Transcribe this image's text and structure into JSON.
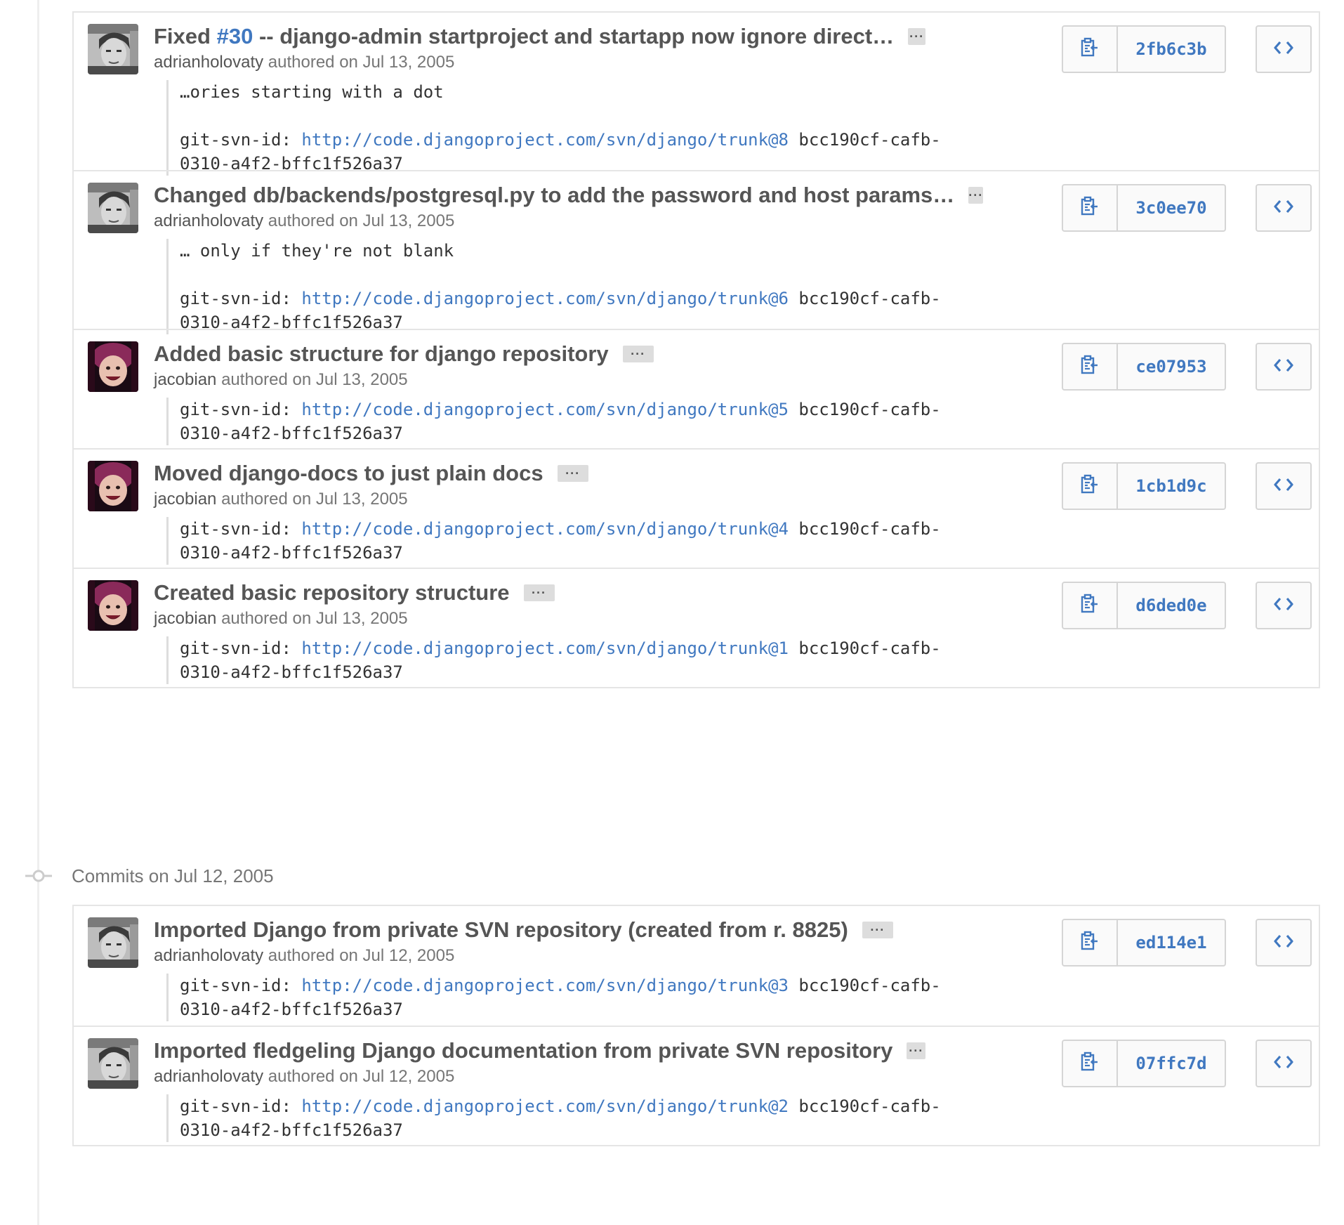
{
  "colors": {
    "link": "#4078c0",
    "title": "#555555",
    "meta": "#767676",
    "border": "#e5e5e5"
  },
  "groups": [
    {
      "date_label": "",
      "commits": [
        {
          "title_prefix": "Fixed ",
          "issue": "#30",
          "title_rest": " -- django-admin startproject and startapp now ignore direct…",
          "author": "adrianholovaty",
          "authored": " authored on Jul 13, 2005",
          "desc_first": "…ories starting with a dot",
          "svn_label": "git-svn-id: ",
          "svn_url": "http://code.djangoproject.com/svn/django/trunk@8",
          "svn_rest": " bcc190cf-cafb-\n0310-a4f2-bffc1f526a37",
          "sha": "2fb6c3b",
          "avatar": "adrian-avatar"
        },
        {
          "title_prefix": "Changed db/backends/postgresql.py to add the password and host params…",
          "issue": "",
          "title_rest": "",
          "author": "adrianholovaty",
          "authored": " authored on Jul 13, 2005",
          "desc_first": "… only if they're not blank",
          "svn_label": "git-svn-id: ",
          "svn_url": "http://code.djangoproject.com/svn/django/trunk@6",
          "svn_rest": " bcc190cf-cafb-\n0310-a4f2-bffc1f526a37",
          "sha": "3c0ee70",
          "avatar": "adrian-avatar"
        },
        {
          "title_prefix": "Added basic structure for django repository",
          "issue": "",
          "title_rest": "",
          "author": "jacobian",
          "authored": " authored on Jul 13, 2005",
          "desc_first": "",
          "svn_label": "git-svn-id: ",
          "svn_url": "http://code.djangoproject.com/svn/django/trunk@5",
          "svn_rest": " bcc190cf-cafb-\n0310-a4f2-bffc1f526a37",
          "sha": "ce07953",
          "avatar": "jacob-avatar"
        },
        {
          "title_prefix": "Moved django-docs to just plain docs",
          "issue": "",
          "title_rest": "",
          "author": "jacobian",
          "authored": " authored on Jul 13, 2005",
          "desc_first": "",
          "svn_label": "git-svn-id: ",
          "svn_url": "http://code.djangoproject.com/svn/django/trunk@4",
          "svn_rest": " bcc190cf-cafb-\n0310-a4f2-bffc1f526a37",
          "sha": "1cb1d9c",
          "avatar": "jacob-avatar"
        },
        {
          "title_prefix": "Created basic repository structure",
          "issue": "",
          "title_rest": "",
          "author": "jacobian",
          "authored": " authored on Jul 13, 2005",
          "desc_first": "",
          "svn_label": "git-svn-id: ",
          "svn_url": "http://code.djangoproject.com/svn/django/trunk@1",
          "svn_rest": " bcc190cf-cafb-\n0310-a4f2-bffc1f526a37",
          "sha": "d6ded0e",
          "avatar": "jacob-avatar"
        }
      ]
    },
    {
      "date_label": "Commits on Jul 12, 2005",
      "commits": [
        {
          "title_prefix": "Imported Django from private SVN repository (created from r. 8825)",
          "issue": "",
          "title_rest": "",
          "author": "adrianholovaty",
          "authored": " authored on Jul 12, 2005",
          "desc_first": "",
          "svn_label": "git-svn-id: ",
          "svn_url": "http://code.djangoproject.com/svn/django/trunk@3",
          "svn_rest": " bcc190cf-cafb-\n0310-a4f2-bffc1f526a37",
          "sha": "ed114e1",
          "avatar": "adrian-avatar"
        },
        {
          "title_prefix": "Imported fledgeling Django documentation from private SVN repository",
          "issue": "",
          "title_rest": "",
          "author": "adrianholovaty",
          "authored": " authored on Jul 12, 2005",
          "desc_first": "",
          "svn_label": "git-svn-id: ",
          "svn_url": "http://code.djangoproject.com/svn/django/trunk@2",
          "svn_rest": " bcc190cf-cafb-\n0310-a4f2-bffc1f526a37",
          "sha": "07ffc7d",
          "avatar": "adrian-avatar"
        }
      ]
    }
  ]
}
